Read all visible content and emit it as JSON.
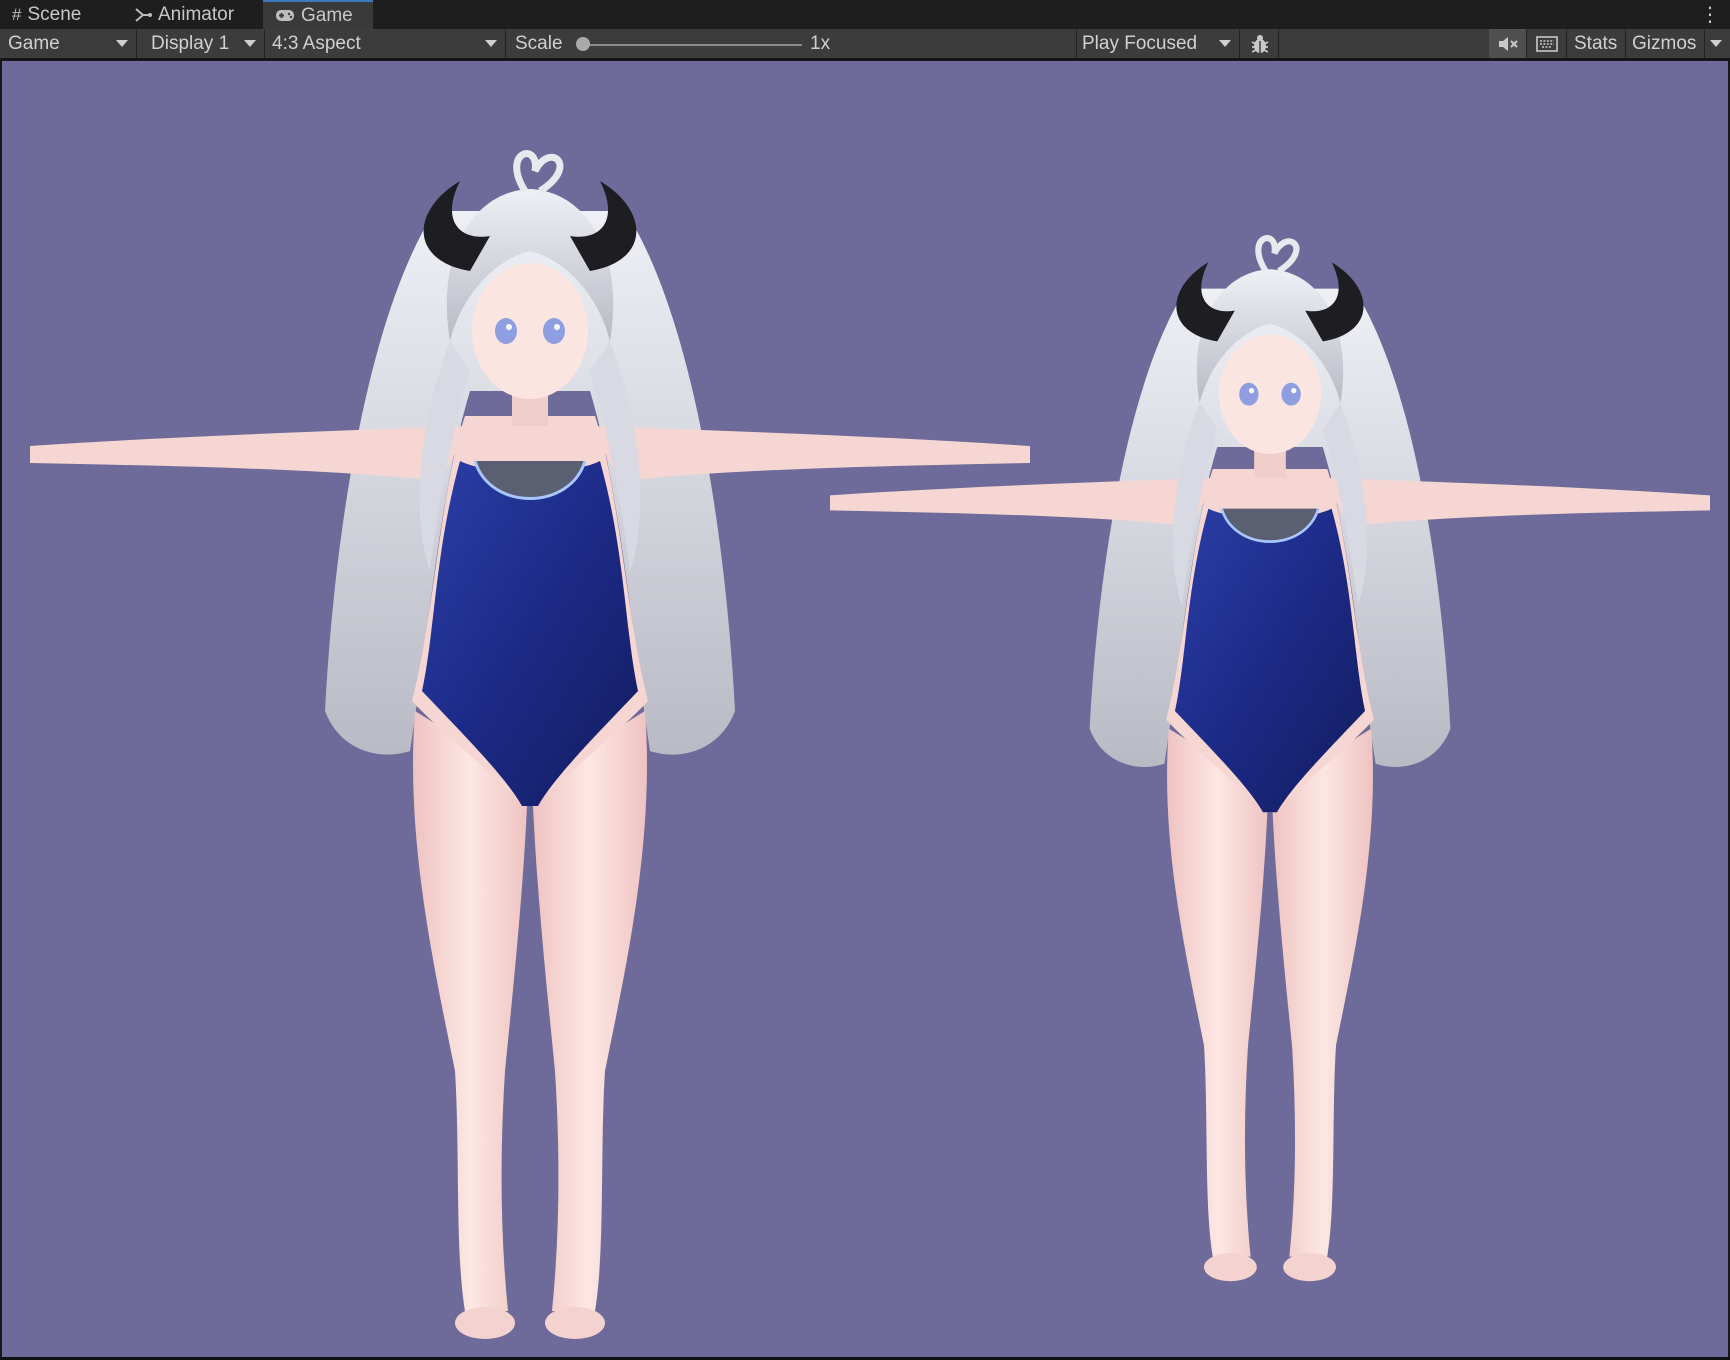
{
  "tabs": [
    {
      "label": "Scene",
      "icon": "hash-icon"
    },
    {
      "label": "Animator",
      "icon": "animator-icon"
    },
    {
      "label": "Game",
      "icon": "gamepad-icon",
      "active": true
    }
  ],
  "toolbar": {
    "game_dropdown": "Game",
    "display_dropdown": "Display 1",
    "aspect_dropdown": "4:3 Aspect",
    "scale_label": "Scale",
    "scale_value": "1x",
    "scale_fraction": 0.0,
    "play_mode_dropdown": "Play Focused",
    "stats_label": "Stats",
    "gizmos_label": "Gizmos"
  },
  "viewport": {
    "background": "#6e6a99",
    "characters": [
      "avatar-left",
      "avatar-right"
    ]
  },
  "colors": {
    "accent": "#3a79bb",
    "skin": "#f6d6d2",
    "hair": "#dcdde6",
    "horn": "#1d1d22",
    "swimsuit": "#1c2c86"
  }
}
